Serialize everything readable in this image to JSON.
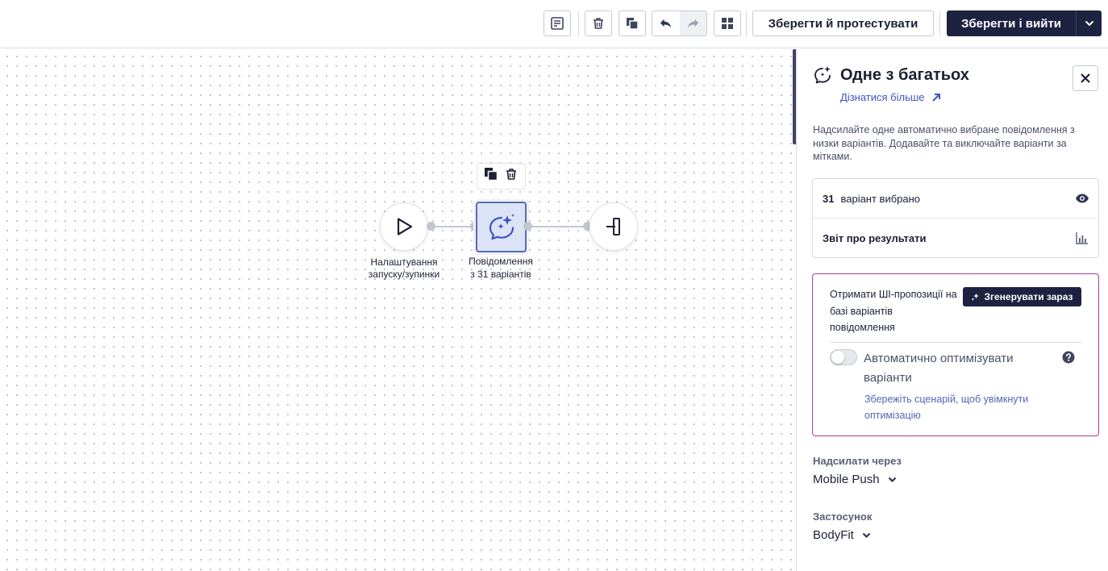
{
  "toolbar": {
    "save_test_label": "Зберегти й протестувати",
    "save_exit_label": "Зберегти і вийти"
  },
  "canvas": {
    "start_node": {
      "label_line1": "Налаштування",
      "label_line2": "запуску/зупинки"
    },
    "message_node": {
      "label_line1": "Повідомлення",
      "label_line2": "з 31 варіантів"
    }
  },
  "panel": {
    "title": "Одне з багатьох",
    "learn_more": "Дізнатися більше",
    "description": "Надсилайте одне автоматично вибране повідомлення з низки варіантів. Додавайте та виключайте варіанти за мітками.",
    "variants_count": "31",
    "variants_text": "варіант вибрано",
    "report_label": "Звіт про результати",
    "ai": {
      "text": "Отримати ШІ-пропозиції на базі варіантів повідомлення",
      "generate_label": "Згенерувати зараз",
      "optimize_label": "Автоматично оптимізувати варіанти",
      "optimize_enabled": false,
      "optimize_hint": "Збережіть сценарій, щоб увімкнути оптимізацію"
    },
    "send_via": {
      "label": "Надсилати через",
      "value": "Mobile Push"
    },
    "app": {
      "label": "Застосунок",
      "value": "BodyFit"
    }
  },
  "colors": {
    "primary_dark": "#1c2240",
    "accent_blue": "#3d55c2",
    "ai_border": "#b33aa3"
  }
}
